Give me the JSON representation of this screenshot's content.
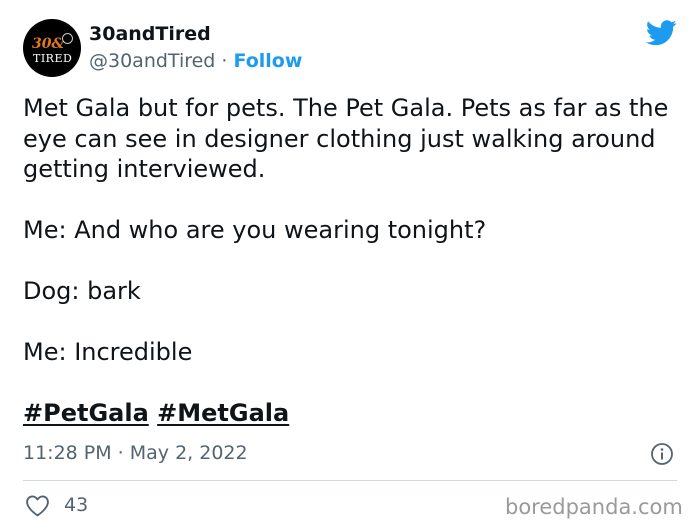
{
  "author": {
    "display_name": "30andTired",
    "handle": "@30andTired",
    "separator": "·",
    "follow_label": "Follow",
    "avatar_top": "30&",
    "avatar_bottom": "TIRED"
  },
  "tweet": {
    "paragraphs": [
      "Met Gala but for pets. The Pet Gala. Pets as far as the eye can see in designer clothing just walking around getting interviewed.",
      "Me: And who are you wearing tonight?",
      "Dog: bark",
      "Me: Incredible"
    ],
    "hashtags": [
      "#PetGala",
      "#MetGala"
    ],
    "timestamp": "11:28 PM · May 2, 2022"
  },
  "engagement": {
    "likes": "43"
  },
  "watermark": "boredpanda.com",
  "icons": {
    "brand": "twitter-bird-icon",
    "info": "info-icon",
    "like": "heart-icon"
  },
  "colors": {
    "brand_blue": "#1d9bf0",
    "text_primary": "#0f1419",
    "text_secondary": "#536471",
    "divider": "#cfd9de",
    "avatar_accent": "#e07a1f"
  }
}
